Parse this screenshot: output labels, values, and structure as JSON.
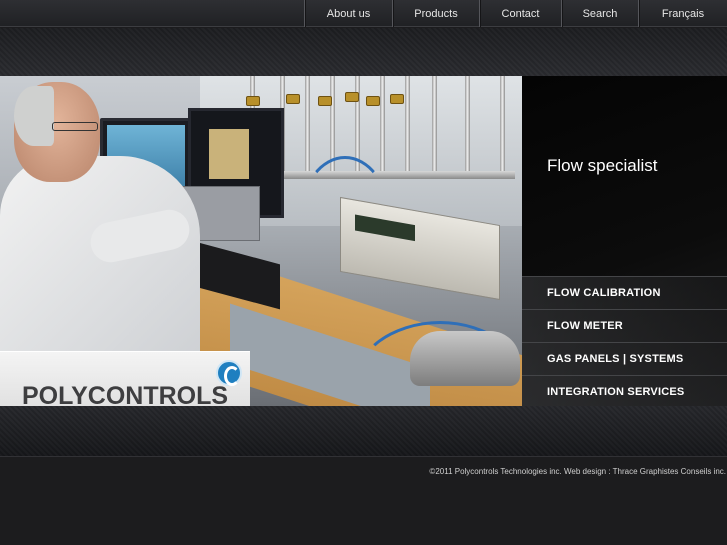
{
  "nav": {
    "items": [
      {
        "label": "About us"
      },
      {
        "label": "Products"
      },
      {
        "label": "Contact"
      },
      {
        "label": "Search"
      },
      {
        "label": "Français"
      }
    ]
  },
  "hero": {
    "logo_text": "POLYCONTROLS"
  },
  "side": {
    "title": "Flow specialist",
    "menu": [
      {
        "label": "FLOW CALIBRATION"
      },
      {
        "label": "FLOW METER"
      },
      {
        "label": "GAS PANELS | SYSTEMS"
      },
      {
        "label": "INTEGRATION SERVICES"
      }
    ]
  },
  "footer": {
    "copyright": "©2011 Polycontrols Technologies inc. Web design : Thrace Graphistes Conseils inc."
  },
  "colors": {
    "background": "#1c1c1e",
    "logo_blue": "#1f7fc0",
    "side_panel": "#050505"
  }
}
